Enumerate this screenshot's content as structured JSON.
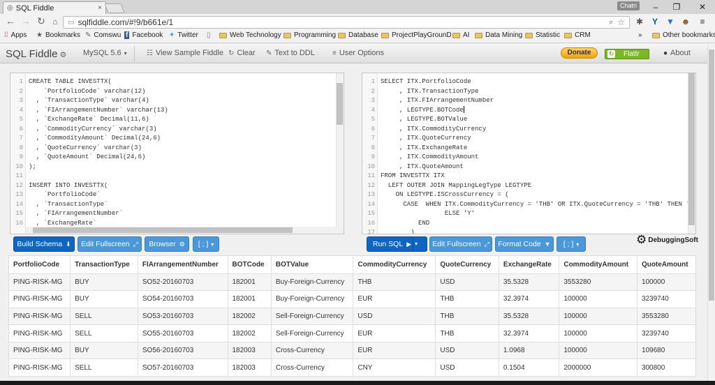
{
  "browser": {
    "tab_title": "SQL Fiddle",
    "tab_close": "×",
    "user_badge": "Chatri",
    "url": "sqlfiddle.com/#!9/b661e/1",
    "bookmarks": [
      {
        "label": "Apps",
        "icon": "apps-icon"
      },
      {
        "label": "Bookmarks",
        "icon": "star-icon"
      },
      {
        "label": "Comswu",
        "icon": "comswu-icon"
      },
      {
        "label": "Facebook",
        "icon": "facebook-icon"
      },
      {
        "label": "Twitter",
        "icon": "twitter-icon"
      },
      {
        "label": "",
        "icon": "page-icon"
      },
      {
        "label": "Web Technology",
        "icon": "folder-icon"
      },
      {
        "label": "Programming",
        "icon": "folder-icon"
      },
      {
        "label": "Database",
        "icon": "folder-icon"
      },
      {
        "label": "ProjectPlayGrounD",
        "icon": "folder-icon"
      },
      {
        "label": "AI",
        "icon": "folder-icon"
      },
      {
        "label": "Data Mining",
        "icon": "folder-icon"
      },
      {
        "label": "Statistic",
        "icon": "folder-icon"
      },
      {
        "label": "CRM",
        "icon": "folder-icon"
      }
    ],
    "more_bookmarks": "»",
    "other_bookmarks": "Other bookmarks"
  },
  "fiddle_nav": {
    "brand": "SQL Fiddle",
    "db_version": "MySQL 5.6",
    "view_sample": "View Sample Fiddle",
    "clear": "Clear",
    "text_to_ddl": "Text to DDL",
    "user_options": "User Options",
    "donate": "Donate",
    "flattr": "Flattr",
    "about": "About"
  },
  "schema_editor": {
    "lines": [
      {
        "n": "1",
        "code": "CREATE TABLE INVESTTX("
      },
      {
        "n": "2",
        "code": "    `PortfolioCode` varchar(12)"
      },
      {
        "n": "3",
        "code": "  , `TransactionType` varchar(4)"
      },
      {
        "n": "4",
        "code": "  , `FIArrangementNumber` varchar(13)"
      },
      {
        "n": "5",
        "code": "  , `ExchangeRate` Decimal(11,6)"
      },
      {
        "n": "6",
        "code": "  , `CommodityCurrency` varchar(3)"
      },
      {
        "n": "7",
        "code": "  , `CommodityAmount` Decimal(24,6)"
      },
      {
        "n": "8",
        "code": "  , `QuoteCurrency` varchar(3)"
      },
      {
        "n": "9",
        "code": "  , `QuoteAmount` Decimal(24,6)"
      },
      {
        "n": "10",
        "code": ");"
      },
      {
        "n": "11",
        "code": ""
      },
      {
        "n": "12",
        "code": "INSERT INTO INVESTTX("
      },
      {
        "n": "13",
        "code": "    `PortfolioCode`"
      },
      {
        "n": "14",
        "code": "  , `TransactionType`"
      },
      {
        "n": "15",
        "code": "  , `FIArrangementNumber`"
      },
      {
        "n": "16",
        "code": "  , `ExchangeRate`"
      }
    ]
  },
  "query_editor": {
    "lines": [
      {
        "n": "1",
        "code": "SELECT ITX.PortfolioCode"
      },
      {
        "n": "2",
        "code": "     , ITX.TransactionType"
      },
      {
        "n": "3",
        "code": "     , ITX.FIArrangementNumber"
      },
      {
        "n": "4",
        "code": "     , LEGTYPE.BOTCode"
      },
      {
        "n": "5",
        "code": "     , LEGTYPE.BOTValue"
      },
      {
        "n": "6",
        "code": "     , ITX.CommodityCurrency"
      },
      {
        "n": "7",
        "code": "     , ITX.QuoteCurrency"
      },
      {
        "n": "8",
        "code": "     , ITX.ExchangeRate"
      },
      {
        "n": "9",
        "code": "     , ITX.CommodityAmount"
      },
      {
        "n": "10",
        "code": "     , ITX.QuoteAmount"
      },
      {
        "n": "11",
        "code": "FROM INVESTTX ITX"
      },
      {
        "n": "12",
        "code": "  LEFT OUTER JOIN MappingLegType LEGTYPE"
      },
      {
        "n": "13",
        "code": "    ON LEGTYPE.ISCrossCurrency = ("
      },
      {
        "n": "14",
        "code": "      CASE  WHEN ITX.CommodityCurrency = 'THB' OR ITX.QuoteCurrency = 'THB' THEN 'N'"
      },
      {
        "n": "15",
        "code": "                 ELSE 'Y'"
      },
      {
        "n": "16",
        "code": "          END"
      },
      {
        "n": "17",
        "code": "        )"
      }
    ]
  },
  "buttons": {
    "build_schema": "Build Schema",
    "edit_fullscreen_left": "Edit Fullscreen",
    "browser": "Browser",
    "delimiter_left": "[ ; ]",
    "run_sql": "Run SQL",
    "edit_fullscreen_right": "Edit Fullscreen",
    "format_code": "Format Code",
    "delimiter_right": "[ ; ]"
  },
  "logo_text": "DebuggingSoft",
  "results": {
    "columns": [
      "PortfolioCode",
      "TransactionType",
      "FIArrangementNumber",
      "BOTCode",
      "BOTValue",
      "CommodityCurrency",
      "QuoteCurrency",
      "ExchangeRate",
      "CommodityAmount",
      "QuoteAmount"
    ],
    "rows": [
      [
        "PING-RISK-MG",
        "BUY",
        "SO52-20160703",
        "182001",
        "Buy-Foreign-Currency",
        "THB",
        "USD",
        "35.5328",
        "3553280",
        "100000"
      ],
      [
        "PING-RISK-MG",
        "BUY",
        "SO54-20160703",
        "182001",
        "Buy-Foreign-Currency",
        "EUR",
        "THB",
        "32.3974",
        "100000",
        "3239740"
      ],
      [
        "PING-RISK-MG",
        "SELL",
        "SO53-20160703",
        "182002",
        "Sell-Foreign-Currency",
        "USD",
        "THB",
        "35.5328",
        "100000",
        "3553280"
      ],
      [
        "PING-RISK-MG",
        "SELL",
        "SO55-20160703",
        "182002",
        "Sell-Foreign-Currency",
        "EUR",
        "THB",
        "32.3974",
        "100000",
        "3239740"
      ],
      [
        "PING-RISK-MG",
        "BUY",
        "SO56-20160703",
        "182003",
        "Cross-Currency",
        "EUR",
        "USD",
        "1.0968",
        "100000",
        "109680"
      ],
      [
        "PING-RISK-MG",
        "SELL",
        "SO57-20160703",
        "182003",
        "Cross-Currency",
        "CNY",
        "USD",
        "0.1504",
        "2000000",
        "300800"
      ]
    ]
  }
}
